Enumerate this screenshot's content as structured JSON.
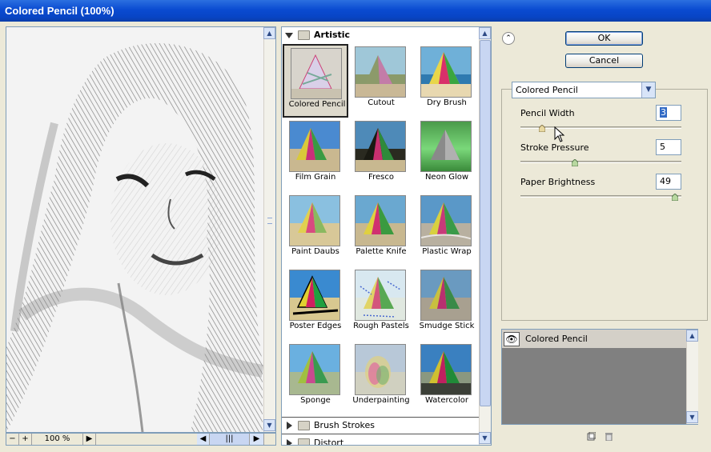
{
  "window": {
    "title": "Colored Pencil (100%)"
  },
  "preview": {
    "zoom_label": "100 %",
    "minus_label": "−",
    "plus_label": "+"
  },
  "gallery": {
    "category_open": "Artistic",
    "selected": "Colored Pencil",
    "filters": [
      "Colored Pencil",
      "Cutout",
      "Dry Brush",
      "Film Grain",
      "Fresco",
      "Neon Glow",
      "Paint Daubs",
      "Palette Knife",
      "Plastic Wrap",
      "Poster Edges",
      "Rough Pastels",
      "Smudge Stick",
      "Sponge",
      "Underpainting",
      "Watercolor"
    ],
    "categories_closed": [
      "Brush Strokes",
      "Distort"
    ]
  },
  "buttons": {
    "ok": "OK",
    "cancel": "Cancel"
  },
  "settings": {
    "filter_select": "Colored Pencil",
    "params": [
      {
        "label": "Pencil Width",
        "value": "3",
        "level": 0.12
      },
      {
        "label": "Stroke Pressure",
        "value": "5",
        "level": 0.33
      },
      {
        "label": "Paper Brightness",
        "value": "49",
        "level": 0.98
      }
    ]
  },
  "layers": {
    "items": [
      "Colored Pencil"
    ]
  },
  "colors": {
    "titlebar": "#0a4bd1",
    "selection_border": "#222222",
    "panel_bg": "#ece9d8"
  }
}
